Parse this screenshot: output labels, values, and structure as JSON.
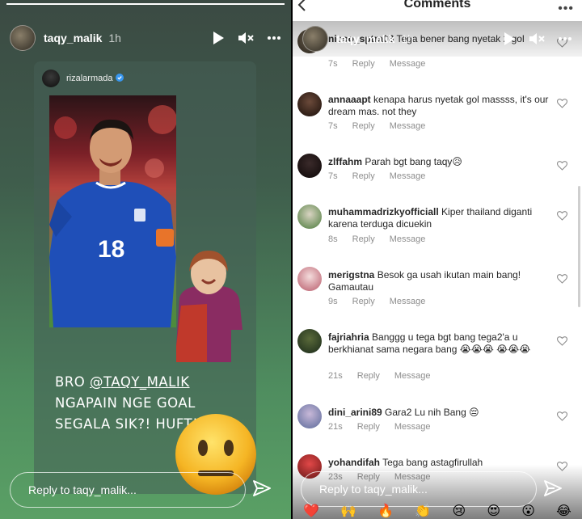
{
  "story": {
    "username": "taqy_malik",
    "time": "1h",
    "progress": 1.0,
    "reshared_from": "rizalarmada",
    "caption_pre": "BRO ",
    "caption_mention": "@TAQY_MALIK",
    "caption_post": " NGAPAIN NGE GOAL SEGALA SIK?! HUFT!!",
    "jersey_number": "18",
    "reply_placeholder": "Reply to taqy_malik..."
  },
  "comments_panel": {
    "title": "Comments",
    "overlay_username": "taqy_malik",
    "overlay_time": "1h",
    "reply_placeholder": "Reply to taqy_malik...",
    "reactions": [
      "❤️",
      "🙌",
      "🔥",
      "👏",
      "😢",
      "😍",
      "😮",
      "😂"
    ],
    "comments": [
      {
        "user": "nicoo_sptra08",
        "text": "Tega bener bang nyetak 2 gol",
        "time": "7s",
        "reply": "Reply",
        "message": "Message"
      },
      {
        "user": "annaaapt",
        "text": "kenapa harus nyetak gol massss, it's our dream mas. not they",
        "time": "7s",
        "reply": "Reply",
        "message": "Message"
      },
      {
        "user": "zlffahm",
        "text": "Parah bgt bang taqy😥",
        "time": "7s",
        "reply": "Reply",
        "message": "Message"
      },
      {
        "user": "muhammadrizkyofficiall",
        "text": "Kiper thailand diganti karena terduga dicuekin",
        "time": "8s",
        "reply": "Reply",
        "message": "Message"
      },
      {
        "user": "merigstna",
        "text": "Besok ga usah ikutan main bang! Gamautau",
        "time": "9s",
        "reply": "Reply",
        "message": "Message"
      },
      {
        "user": "fajriahria",
        "text": "Banggg u tega bgt bang tega2'a u berkhianat sama negara bang 😭😭😭 😭😭😭",
        "time": "21s",
        "reply": "Reply",
        "message": "Message"
      },
      {
        "user": "dini_arini89",
        "text": "Gara2 Lu nih Bang 😔",
        "time": "21s",
        "reply": "Reply",
        "message": "Message"
      },
      {
        "user": "yohandifah",
        "text": "Tega bang astagfirullah",
        "time": "23s",
        "reply": "Reply",
        "message": "Message"
      }
    ]
  }
}
